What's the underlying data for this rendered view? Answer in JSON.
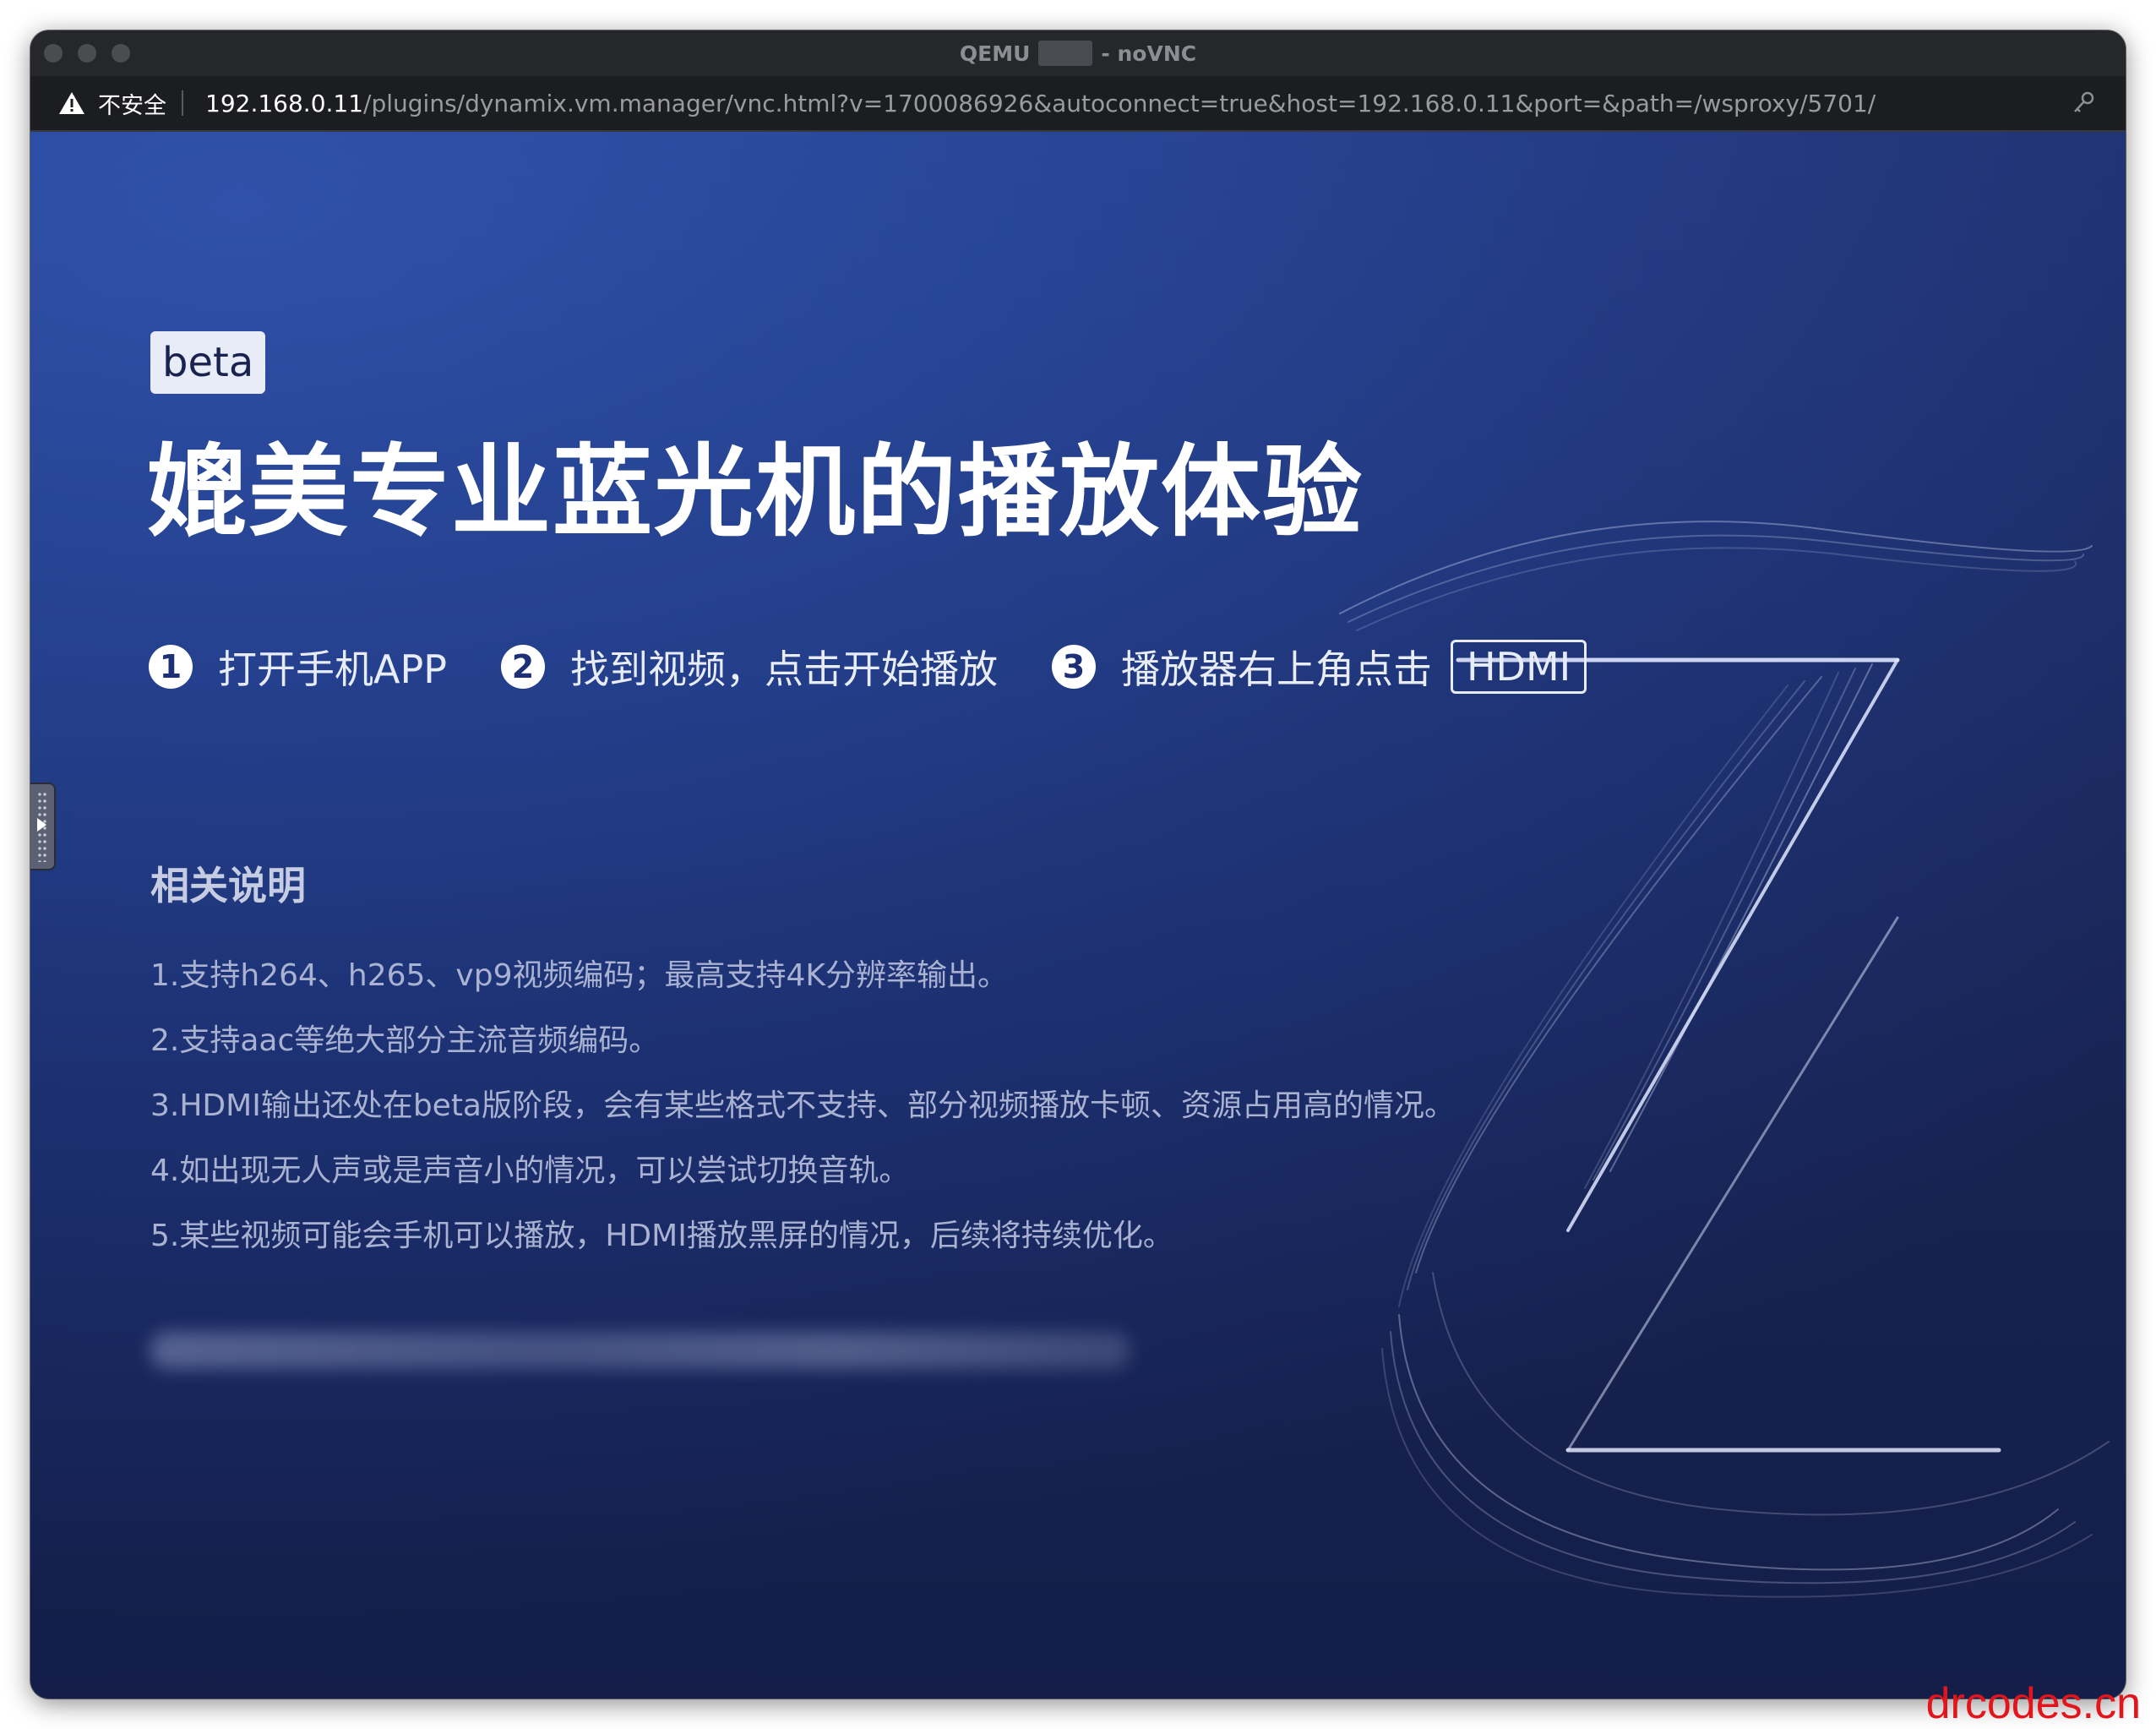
{
  "window": {
    "title_left": "QEMU",
    "title_right": "- noVNC"
  },
  "addressbar": {
    "security_label": "不安全",
    "url_host": "192.168.0.11",
    "url_path": "/plugins/dynamix.vm.manager/vnc.html?v=1700086926&autoconnect=true&host=192.168.0.11&port=&path=/wsproxy/5701/"
  },
  "screen": {
    "badge": "beta",
    "headline": "媲美专业蓝光机的播放体验",
    "steps": [
      {
        "num": "1",
        "text": "打开手机APP"
      },
      {
        "num": "2",
        "text": "找到视频，点击开始播放"
      },
      {
        "num": "3",
        "text": "播放器右上角点击"
      }
    ],
    "hdmi_label": "HDMI",
    "notes_title": "相关说明",
    "notes": [
      "1.支持h264、h265、vp9视频编码；最高支持4K分辨率输出。",
      "2.支持aac等绝大部分主流音频编码。",
      "3.HDMI输出还处在beta版阶段，会有某些格式不支持、部分视频播放卡顿、资源占用高的情况。",
      "4.如出现无人声或是声音小的情况，可以尝试切换音轨。",
      "5.某些视频可能会手机可以播放，HDMI播放黑屏的情况，后续将持续优化。"
    ]
  },
  "watermark": "drcodes.cn",
  "colors": {
    "accent_blue": "#2a4ca8",
    "watermark_red": "#e3151c"
  }
}
